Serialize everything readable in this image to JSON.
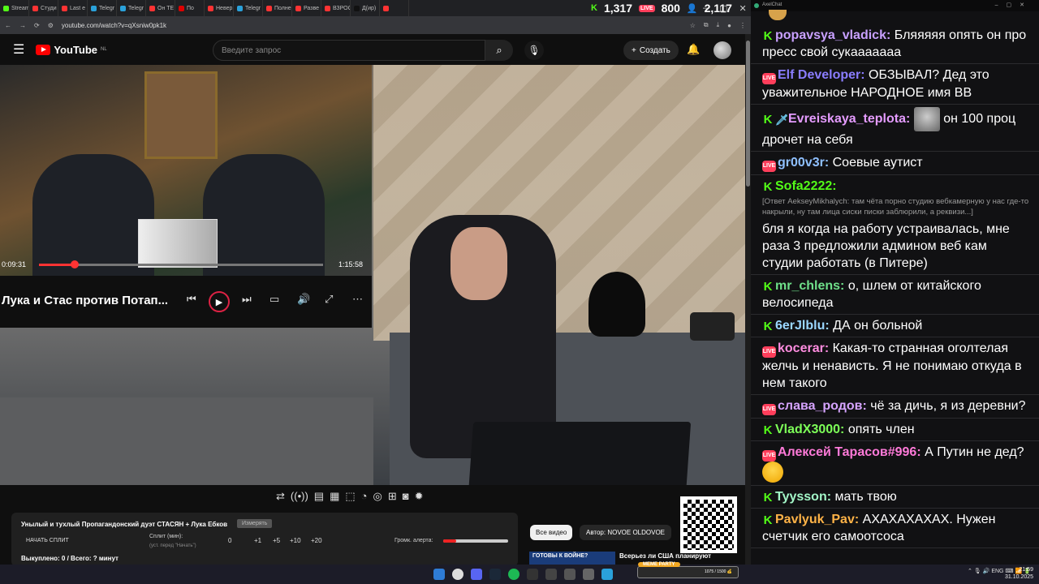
{
  "browser": {
    "tabs": [
      "Stream",
      "Студи",
      "Last e",
      "Telegr",
      "Telegr",
      "Он ТЕ",
      "По",
      "Невер",
      "Telegr",
      "Полне",
      "Разве",
      "ВЗРОС",
      "Д(ир)",
      ""
    ],
    "url": "youtube.com/watch?v=qXsniw0pk1k"
  },
  "stream_stats": {
    "kick_viewers": "1,317",
    "live_viewers": "800",
    "followers": "2,117"
  },
  "youtube": {
    "logo": "YouTube",
    "region": "NL",
    "search_placeholder": "Введите запрос",
    "create_label": "Создать"
  },
  "mini_player": {
    "time_current": "0:09:31",
    "time_total": "1:15:58",
    "progress_fraction": 0.126,
    "title": "Лука и Стас против Потап..."
  },
  "stream_panel": {
    "title": "Унылый и тухлый Пропагандонский дуэт СТАСЯН + Лука Ебков",
    "button": "Измерять",
    "split_start": "НАЧАТЬ СПЛИТ",
    "split_label": "Сплит (мин):",
    "split_hint": "(уст. перед \"Начать\")",
    "split_values": [
      "0",
      "+1",
      "+5",
      "+10",
      "+20"
    ],
    "alert_label": "Громк. алерта:",
    "alert_level": 0.2,
    "stats": "Выкуплено: 0 / Всего: ? минут"
  },
  "tabs_row": {
    "all_videos": "Все видео",
    "author": "Автор: NOVOE OLDOVOE"
  },
  "recommended": {
    "thumb_text": "ГОТОВЫ К ВОЙНЕ?",
    "title": "Всерьез ли США планируют"
  },
  "chat": {
    "window_title": "AxelChat",
    "messages": [
      {
        "badge": "kick",
        "user": "popavsya_vladick:",
        "color": "#c8a0ff",
        "text": "Бляяяяя опять он про пресс свой сукааааааа"
      },
      {
        "badge": "live",
        "user": "Elf Developer:",
        "color": "#8a7dff",
        "text": "ОБЗЫВАЛ? Дед это уважительное НАРОДНОЕ имя ВВ"
      },
      {
        "badge": "kick",
        "badge2": "sword",
        "user": "Evreiskaya_teplota:",
        "color": "#e59cff",
        "emote": true,
        "text": "он 100 проц дрочет на себя"
      },
      {
        "badge": "live",
        "user": "gr00v3r:",
        "color": "#8fc0ff",
        "text": "Соевые аутист"
      },
      {
        "badge": "kick",
        "user": "Sofa2222:",
        "color": "#53fc18",
        "reply": "[Ответ AekseyMikhalych: там чёта порно студию вебкамерную у нас где-то накрыли, ну там лица сиски писки заблюрили, а реквизи...]",
        "text": "бля я когда на работу устраивалась, мне раза 3 предложили админом веб кам студии работать (в Питере)"
      },
      {
        "badge": "kick",
        "user": "mr_chlens:",
        "color": "#6fe08a",
        "text": "о, шлем от китайского велосипеда"
      },
      {
        "badge": "kick",
        "user": "6erJlblu:",
        "color": "#9ad7ff",
        "text": "ДА он больной"
      },
      {
        "badge": "live",
        "user": "kocerar:",
        "color": "#ff8de0",
        "text": "Какая-то странная оголтелая желчь и ненависть. Я не понимаю откуда в нем такого"
      },
      {
        "badge": "live",
        "user": "слава_родов:",
        "color": "#d6a4ff",
        "text": "чё за дичь, я из деревни?"
      },
      {
        "badge": "kick",
        "user": "VladX3000:",
        "color": "#7dff58",
        "text": "опять член"
      },
      {
        "badge": "live",
        "user": "Алексей Тарасов#996:",
        "color": "#ff7ad9",
        "text": "А Путин не дед?",
        "emote_after": true
      },
      {
        "badge": "kick",
        "user": "Tyysson:",
        "color": "#a3f7c8",
        "text": "мать твою"
      },
      {
        "badge": "kick",
        "user": "Pavlyuk_Pav:",
        "color": "#ffb347",
        "text": "АХАХАХАХАХ. Нужен счетчик его самоотсоса"
      }
    ]
  },
  "taskbar": {
    "overlay_label": "MEME PARTY",
    "overlay_value": "1075 / 1500 💰",
    "lang": "ENG",
    "time": "21:59",
    "date": "31.10.2025"
  }
}
